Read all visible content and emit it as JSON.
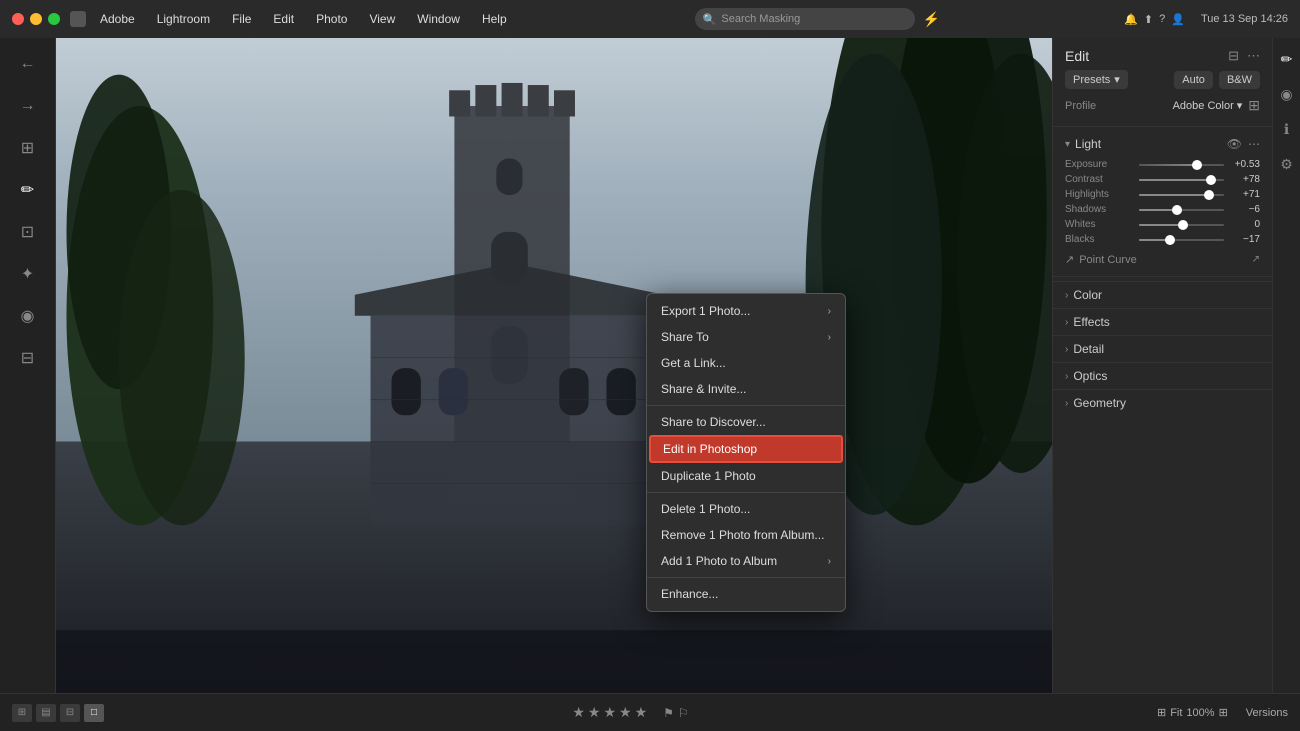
{
  "titlebar": {
    "app_name": "Adobe Lightroom",
    "menus": [
      "Adobe",
      "Lightroom",
      "File",
      "Edit",
      "Photo",
      "View",
      "Window",
      "Help"
    ],
    "search_placeholder": "Search Masking",
    "time": "Tue 13 Sep 14:26"
  },
  "context_menu": {
    "items": [
      {
        "label": "Export 1 Photo...",
        "has_arrow": true,
        "separator_after": false
      },
      {
        "label": "Share To",
        "has_arrow": true,
        "separator_after": false
      },
      {
        "label": "Get a Link...",
        "has_arrow": false,
        "separator_after": false
      },
      {
        "label": "Share & Invite...",
        "has_arrow": false,
        "separator_after": true
      },
      {
        "label": "Share to Discover...",
        "has_arrow": false,
        "separator_after": false
      },
      {
        "label": "Edit in Photoshop",
        "has_arrow": false,
        "highlighted": true,
        "separator_after": false
      },
      {
        "label": "Duplicate 1 Photo",
        "has_arrow": false,
        "separator_after": true
      },
      {
        "label": "Delete 1 Photo...",
        "has_arrow": false,
        "separator_after": false
      },
      {
        "label": "Remove 1 Photo from Album...",
        "has_arrow": false,
        "separator_after": false
      },
      {
        "label": "Add 1 Photo to Album",
        "has_arrow": true,
        "separator_after": true
      },
      {
        "label": "Enhance...",
        "has_arrow": false,
        "separator_after": false
      }
    ]
  },
  "right_panel": {
    "title": "Edit",
    "presets_label": "Presets",
    "auto_label": "Auto",
    "bw_label": "B&W",
    "profile_label": "Profile",
    "profile_value": "Adobe Color",
    "sections": {
      "light": {
        "name": "Light",
        "expanded": true,
        "sliders": [
          {
            "label": "Exposure",
            "value": "+0.53",
            "position": 68
          },
          {
            "label": "Contrast",
            "value": "+78",
            "position": 85
          },
          {
            "label": "Highlights",
            "value": "+71",
            "position": 82
          },
          {
            "label": "Shadows",
            "value": "-6",
            "position": 45
          },
          {
            "label": "Whites",
            "value": "0",
            "position": 52
          },
          {
            "label": "Blacks",
            "value": "-17",
            "position": 36
          }
        ],
        "point_curve": "Point Curve",
        "point_curve_value": "↗"
      },
      "color": {
        "name": "Color",
        "expanded": false
      },
      "effects": {
        "name": "Effects",
        "expanded": false
      },
      "detail": {
        "name": "Detail",
        "expanded": false
      },
      "optics": {
        "name": "Optics",
        "expanded": false
      },
      "geometry": {
        "name": "Geometry",
        "expanded": false
      }
    }
  },
  "bottom_toolbar": {
    "fit_label": "Fit",
    "zoom_value": "100%",
    "versions_label": "Versions",
    "stars": [
      "★",
      "★",
      "★",
      "★",
      "★"
    ],
    "flags": [
      "⚑",
      "⚐"
    ]
  }
}
